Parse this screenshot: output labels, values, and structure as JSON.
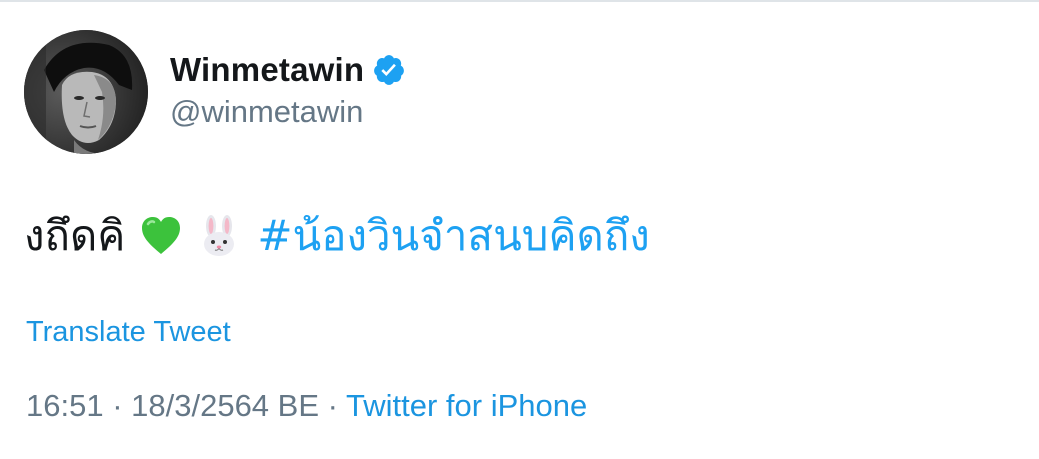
{
  "user": {
    "display_name": "Winmetawin",
    "handle": "@winmetawin",
    "verified": true,
    "verified_color": "#1da1f2"
  },
  "tweet": {
    "text": "งถึดคิ",
    "emojis": [
      "green-heart-emoji",
      "rabbit-face-emoji"
    ],
    "hashtag": "#น้องวินจำสนบคิดถึง"
  },
  "translate_label": "Translate Tweet",
  "meta": {
    "time": "16:51",
    "separator": " · ",
    "date": "18/3/2564 BE",
    "source": "Twitter for iPhone"
  },
  "colors": {
    "link": "#1b95e0",
    "text": "#14171a",
    "muted": "#657786"
  }
}
